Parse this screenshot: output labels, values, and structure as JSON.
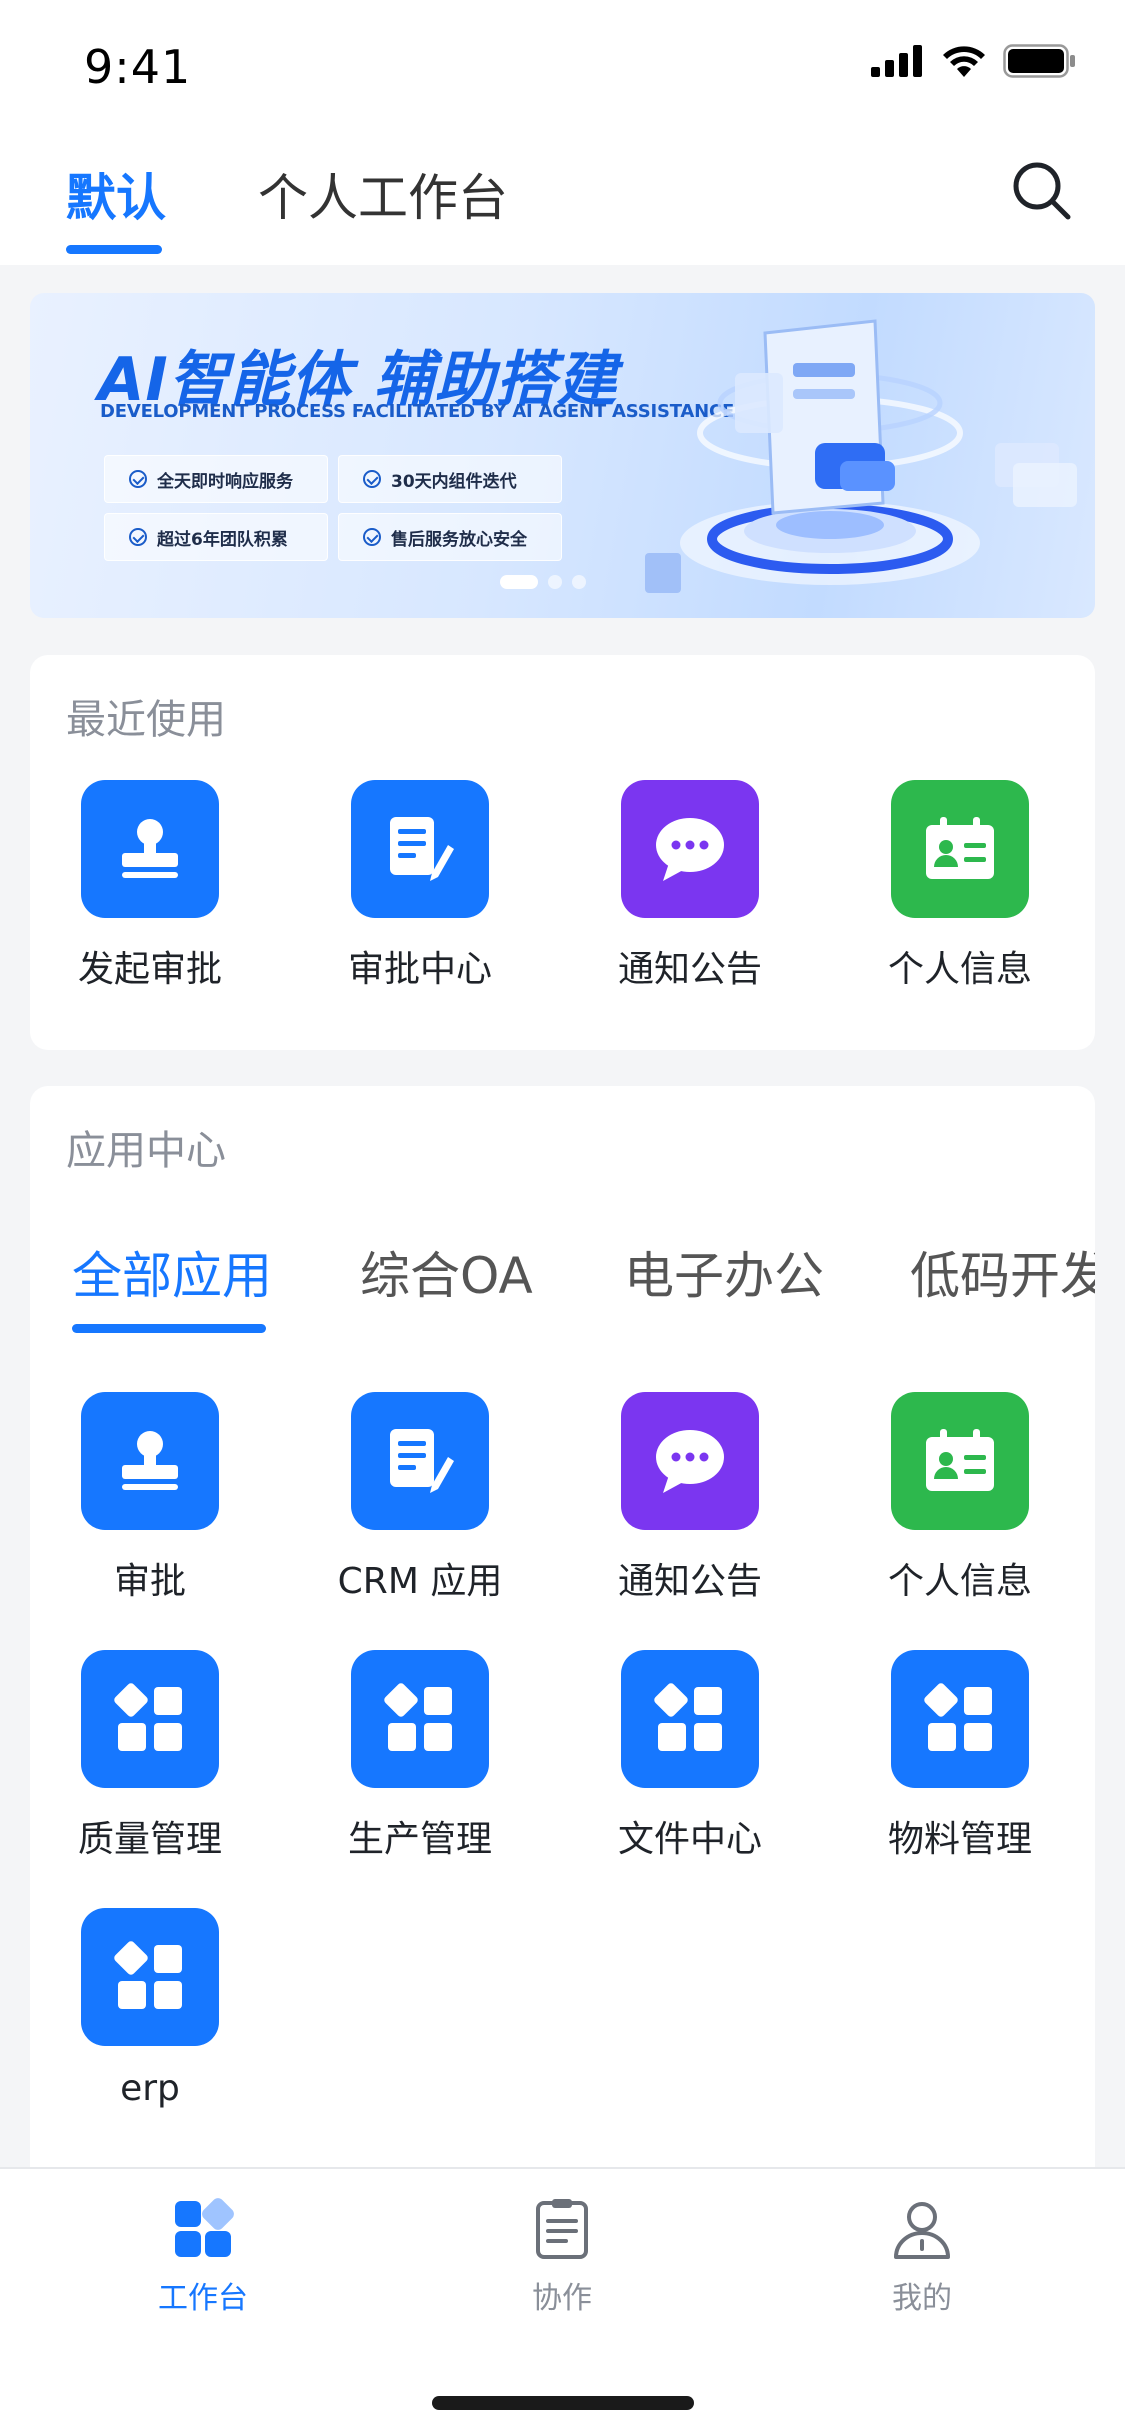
{
  "status_bar": {
    "time": "9:41"
  },
  "header": {
    "tabs": [
      {
        "label": "默认",
        "active": true
      },
      {
        "label": "个人工作台",
        "active": false
      }
    ]
  },
  "banner": {
    "title": "AI智能体 辅助搭建",
    "subtitle": "DEVELOPMENT PROCESS FACILITATED BY AI AGENT ASSISTANCE",
    "badges": [
      "全天即时响应服务",
      "30天内组件迭代",
      "超过6年团队积累",
      "售后服务放心安全"
    ],
    "slide_count": 3,
    "active_slide": 0
  },
  "recent": {
    "title": "最近使用",
    "apps": [
      {
        "label": "发起审批",
        "icon": "stamp-icon",
        "color": "#1677FF"
      },
      {
        "label": "审批中心",
        "icon": "document-edit-icon",
        "color": "#1677FF"
      },
      {
        "label": "通知公告",
        "icon": "chat-bubble-icon",
        "color": "#7B36F0"
      },
      {
        "label": "个人信息",
        "icon": "id-card-icon",
        "color": "#2DB84D"
      }
    ]
  },
  "app_center": {
    "title": "应用中心",
    "tabs": [
      {
        "label": "全部应用",
        "active": true
      },
      {
        "label": "综合OA",
        "active": false
      },
      {
        "label": "电子办公",
        "active": false
      },
      {
        "label": "低码开发",
        "active": false
      }
    ],
    "apps": [
      {
        "label": "审批",
        "icon": "stamp-icon",
        "color": "#1677FF"
      },
      {
        "label": "CRM 应用",
        "icon": "document-edit-icon",
        "color": "#1677FF"
      },
      {
        "label": "通知公告",
        "icon": "chat-bubble-icon",
        "color": "#7B36F0"
      },
      {
        "label": "个人信息",
        "icon": "id-card-icon",
        "color": "#2DB84D"
      },
      {
        "label": "质量管理",
        "icon": "app-grid-icon",
        "color": "#1677FF"
      },
      {
        "label": "生产管理",
        "icon": "app-grid-icon",
        "color": "#1677FF"
      },
      {
        "label": "文件中心",
        "icon": "app-grid-icon",
        "color": "#1677FF"
      },
      {
        "label": "物料管理",
        "icon": "app-grid-icon",
        "color": "#1677FF"
      },
      {
        "label": "erp",
        "icon": "app-grid-icon",
        "color": "#1677FF"
      }
    ]
  },
  "bottom_nav": {
    "items": [
      {
        "label": "工作台",
        "icon": "workbench-icon",
        "active": true
      },
      {
        "label": "协作",
        "icon": "clipboard-icon",
        "active": false
      },
      {
        "label": "我的",
        "icon": "profile-icon",
        "active": false
      }
    ]
  },
  "colors": {
    "accent": "#1677FF",
    "purple": "#7B36F0",
    "green": "#2DB84D",
    "background": "#F4F5F7"
  }
}
